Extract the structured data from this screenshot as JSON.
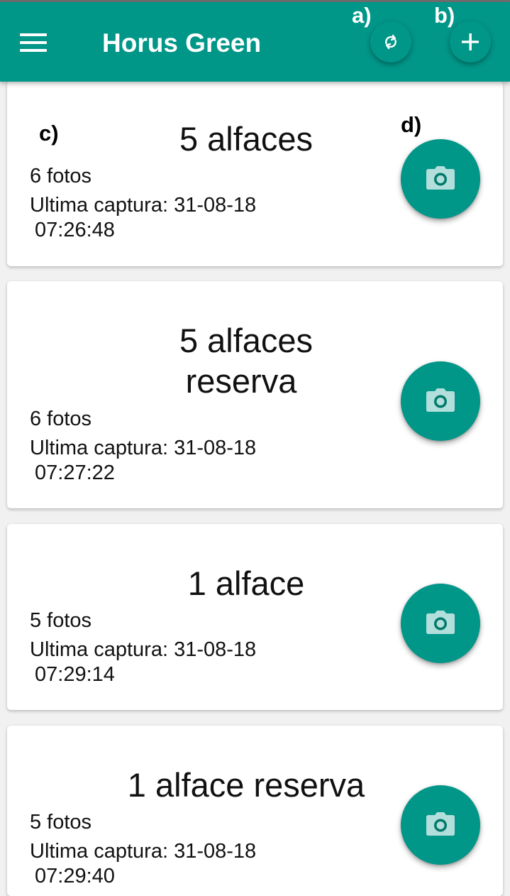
{
  "app": {
    "title": "Horus Green",
    "colors": {
      "primary": "#009688",
      "background": "#f1f1f1",
      "card": "#ffffff",
      "camera_icon": "#b2dfdb"
    }
  },
  "appbar": {
    "menu_icon": "menu-icon",
    "sync_icon": "sync-icon",
    "add_icon": "plus-icon"
  },
  "annotations": {
    "a": "a)",
    "b": "b)",
    "c": "c)",
    "d": "d)"
  },
  "items": [
    {
      "title_lines": [
        "5 alfaces"
      ],
      "photos": "6 fotos",
      "capture_label": "Ultima captura: 31-08-18",
      "capture_time": "07:26:48",
      "camera_icon": "camera-icon"
    },
    {
      "title_lines": [
        "5 alfaces",
        "reserva"
      ],
      "photos": "6 fotos",
      "capture_label": "Ultima captura: 31-08-18",
      "capture_time": "07:27:22",
      "camera_icon": "camera-icon"
    },
    {
      "title_lines": [
        "1 alface"
      ],
      "photos": "5 fotos",
      "capture_label": "Ultima captura: 31-08-18",
      "capture_time": "07:29:14",
      "camera_icon": "camera-icon"
    },
    {
      "title_lines": [
        "1 alface reserva"
      ],
      "photos": "5 fotos",
      "capture_label": "Ultima captura: 31-08-18",
      "capture_time": "07:29:40",
      "camera_icon": "camera-icon"
    }
  ]
}
